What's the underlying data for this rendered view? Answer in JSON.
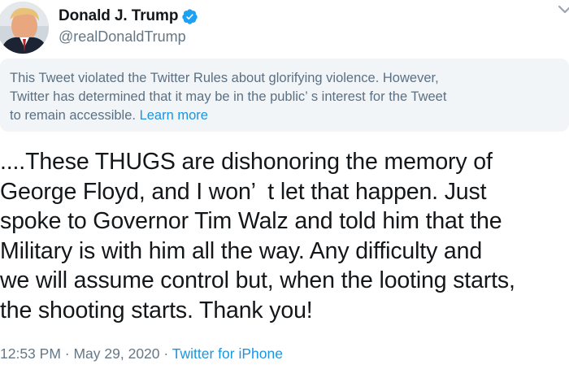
{
  "header": {
    "display_name": "Donald J. Trump",
    "handle": "@realDonaldTrump",
    "verified_icon": "verified-badge-icon",
    "more_icon": "chevron-down-icon",
    "verified_color": "#1da1f2"
  },
  "notice": {
    "text": "This Tweet violated the Twitter Rules about glorifying violence. However,\nTwitter has determined that it may be in the public’ s interest for the Tweet\nto remain accessible. ",
    "link_label": "Learn more",
    "background": "#f2f5f8",
    "link_color": "#1b95e0"
  },
  "tweet": {
    "text": "....These THUGS are dishonoring the memory of\nGeorge Floyd, and I won’  t let that happen. Just\nspoke to Governor Tim Walz and told him that the\nMilitary is with him all the way. Any difficulty and\nwe will assume control but, when the looting starts,\nthe shooting starts. Thank you!"
  },
  "meta": {
    "time": "12:53 PM",
    "separator": " · ",
    "date": "May 29, 2020",
    "separator2": " · ",
    "source": "Twitter for iPhone"
  }
}
